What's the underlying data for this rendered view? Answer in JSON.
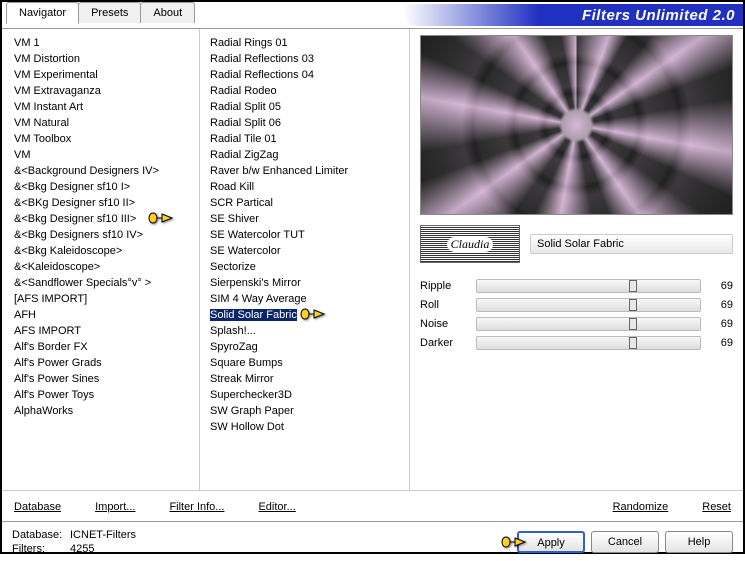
{
  "title": "Filters Unlimited 2.0",
  "tabs": [
    {
      "label": "Navigator",
      "active": true
    },
    {
      "label": "Presets",
      "active": false
    },
    {
      "label": "About",
      "active": false
    }
  ],
  "categories": [
    "VM 1",
    "VM Distortion",
    "VM Experimental",
    "VM Extravaganza",
    "VM Instant Art",
    "VM Natural",
    "VM Toolbox",
    "VM",
    "&<Background Designers IV>",
    "&<Bkg Designer sf10 I>",
    "&<BKg Designer sf10 II>",
    "&<Bkg Designer sf10 III>",
    "&<Bkg Designers sf10 IV>",
    "&<Bkg Kaleidoscope>",
    "&<Kaleidoscope>",
    "&<Sandflower Specials°v° >",
    "[AFS IMPORT]",
    "AFH",
    "AFS IMPORT",
    "Alf's Border FX",
    "Alf's Power Grads",
    "Alf's Power Sines",
    "Alf's Power Toys",
    "AlphaWorks"
  ],
  "categories_pointer_index": 11,
  "filters": [
    "Radial  Rings 01",
    "Radial Reflections 03",
    "Radial Reflections 04",
    "Radial Rodeo",
    "Radial Split 05",
    "Radial Split 06",
    "Radial Tile 01",
    "Radial ZigZag",
    "Raver b/w Enhanced Limiter",
    "Road Kill",
    "SCR  Partical",
    "SE Shiver",
    "SE Watercolor TUT",
    "SE Watercolor",
    "Sectorize",
    "Sierpenski's Mirror",
    "SIM 4 Way Average",
    "Solid Solar Fabric",
    "Splash!...",
    "SpyroZag",
    "Square Bumps",
    "Streak Mirror",
    "Superchecker3D",
    "SW Graph Paper",
    "SW Hollow Dot"
  ],
  "filters_selected_index": 17,
  "logo_text": "Claudia",
  "current_filter": "Solid Solar Fabric",
  "params": [
    {
      "label": "Ripple",
      "value": 69
    },
    {
      "label": "Roll",
      "value": 69
    },
    {
      "label": "Noise",
      "value": 69
    },
    {
      "label": "Darker",
      "value": 69
    }
  ],
  "bottom_links": {
    "database": "Database",
    "import": "Import...",
    "filter_info": "Filter Info...",
    "editor": "Editor...",
    "randomize": "Randomize",
    "reset": "Reset"
  },
  "status": {
    "db_label": "Database:",
    "db_value": "ICNET-Filters",
    "filters_label": "Filters:",
    "filters_value": "4255"
  },
  "buttons": {
    "apply": "Apply",
    "cancel": "Cancel",
    "help": "Help"
  }
}
